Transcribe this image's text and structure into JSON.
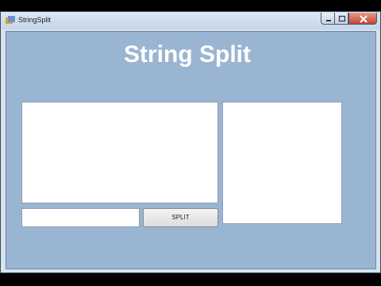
{
  "window": {
    "title": "StringSplit",
    "icon": "app-icon",
    "controls": [
      "minimize-icon",
      "maximize-icon",
      "close-icon"
    ]
  },
  "main": {
    "heading": "String Split",
    "input_text": "",
    "small_input_value": "",
    "output_text": "",
    "split_button_label": "SPLIT"
  },
  "colors": {
    "client_bg": "#9ab5d2",
    "heading": "#ffffff",
    "close_button": "#c4442e"
  }
}
